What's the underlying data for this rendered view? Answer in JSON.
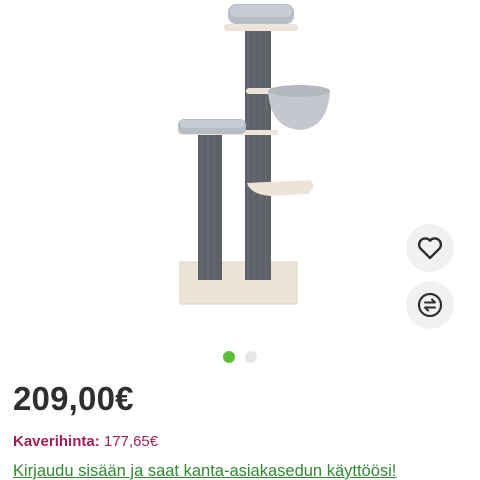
{
  "product": {
    "image_alt": "cat-tree-product-image",
    "price": "209,00€",
    "friend_price_label": "Kaverihinta:",
    "friend_price_value": "177,65€",
    "login_link": "Kirjaudu sisään ja saat kanta-asiakasedun käyttöösi!"
  },
  "gallery": {
    "slides": 2,
    "active_slide": 1,
    "favorite_icon": "heart-icon",
    "compare_icon": "compare-arrows-icon"
  },
  "colors": {
    "accent_green": "#5bbf3a",
    "link_green": "#2e8b2e",
    "friend_price": "#a31d5a",
    "price_text": "#2f2f2f"
  }
}
